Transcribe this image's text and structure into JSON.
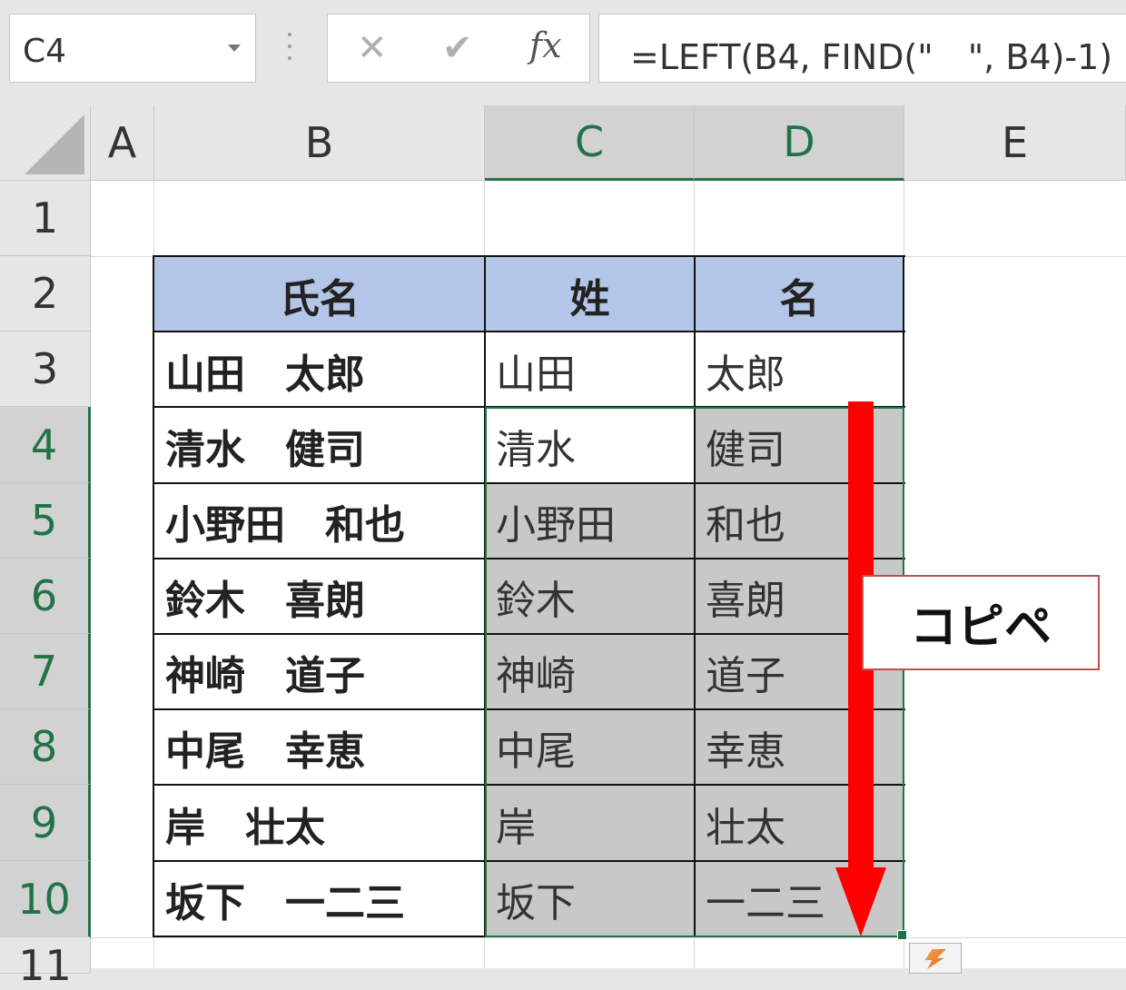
{
  "formula_bar": {
    "name_box": "C4",
    "cancel_icon": "✕",
    "enter_icon": "✔",
    "fx_label": "fx",
    "formula": "=LEFT(B4, FIND(\"　\", B4)-1)"
  },
  "columns": [
    "A",
    "B",
    "C",
    "D",
    "E"
  ],
  "selected_columns": [
    "C",
    "D"
  ],
  "rows": [
    "1",
    "2",
    "3",
    "4",
    "5",
    "6",
    "7",
    "8",
    "9",
    "10",
    "11"
  ],
  "selected_rows": [
    "4",
    "5",
    "6",
    "7",
    "8",
    "9",
    "10"
  ],
  "table": {
    "headers": [
      "氏名",
      "姓",
      "名"
    ],
    "data": [
      {
        "full": "山田　太郎",
        "last": "山田",
        "first": "太郎"
      },
      {
        "full": "清水　健司",
        "last": "清水",
        "first": "健司"
      },
      {
        "full": "小野田　和也",
        "last": "小野田",
        "first": "和也"
      },
      {
        "full": "鈴木　喜朗",
        "last": "鈴木",
        "first": "喜朗"
      },
      {
        "full": "神崎　道子",
        "last": "神崎",
        "first": "道子"
      },
      {
        "full": "中尾　幸恵",
        "last": "中尾",
        "first": "幸恵"
      },
      {
        "full": "岸　壮太",
        "last": "岸",
        "first": "壮太"
      },
      {
        "full": "坂下　一二三",
        "last": "坂下",
        "first": "一二三"
      }
    ]
  },
  "annotation": {
    "label": "コピペ",
    "arrow_color": "#ff0000",
    "border_color": "#c0504d"
  },
  "colors": {
    "header_fill": "#b4c6e7",
    "selection_fill": "#c8c8c8",
    "selection_border": "#217346"
  }
}
